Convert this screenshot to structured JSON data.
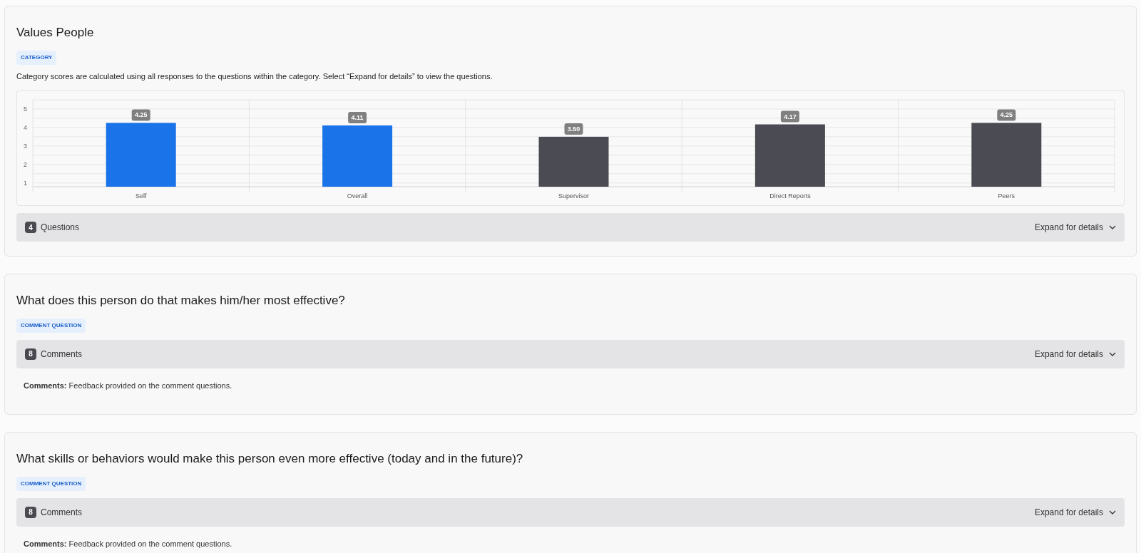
{
  "sections": [
    {
      "kind": "category",
      "title": "Values People",
      "badge": "CATEGORY",
      "description": "Category scores are calculated using all responses to the questions within the category. Select “Expand for details” to view the questions.",
      "chart_data": {
        "type": "bar",
        "categories": [
          "Self",
          "Overall",
          "Supervisor",
          "Direct Reports",
          "Peers"
        ],
        "series": [
          {
            "color": "#1a73e8",
            "values": [
              4.25,
              4.11,
              null,
              null,
              null
            ]
          },
          {
            "color": "#4b4b53",
            "values": [
              null,
              null,
              3.5,
              4.17,
              4.25
            ]
          }
        ],
        "stacked": true,
        "grid": true,
        "ylim": [
          0.8,
          5.5
        ],
        "yticks": [
          1,
          2,
          3,
          4,
          5
        ],
        "value_labels": [
          "4.25",
          "4.11",
          "3.50",
          "4.17",
          "4.25"
        ]
      },
      "summary": {
        "count": "4",
        "label": "Questions",
        "action": "Expand for details",
        "expanded": false
      }
    },
    {
      "kind": "comment",
      "title": "What does this person do that makes him/her most effective?",
      "badge": "COMMENT QUESTION",
      "summary": {
        "count": "8",
        "label": "Comments",
        "action": "Expand for details",
        "expanded": false
      },
      "note": "**Comments:** Feedback provided on the comment questions."
    },
    {
      "kind": "comment",
      "title": "What skills or behaviors would make this person even more effective (today and in the future)?",
      "badge": "COMMENT QUESTION",
      "summary": {
        "count": "8",
        "label": "Comments",
        "action": "Expand for details",
        "expanded": false
      },
      "note": "**Comments:** Feedback provided on the comment questions."
    }
  ]
}
